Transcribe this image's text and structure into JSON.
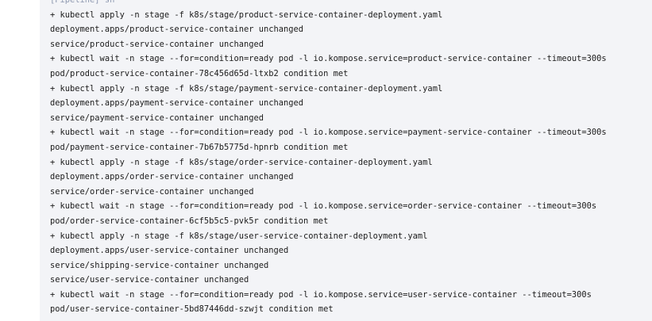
{
  "console": {
    "lines": [
      {
        "text": "[Pipeline] sh",
        "kind": "meta"
      },
      {
        "text": "+ kubectl apply -n stage -f k8s/stage/product-service-container-deployment.yaml",
        "kind": "command"
      },
      {
        "text": "deployment.apps/product-service-container unchanged",
        "kind": "output"
      },
      {
        "text": "service/product-service-container unchanged",
        "kind": "output"
      },
      {
        "text": "+ kubectl wait -n stage --for=condition=ready pod -l io.kompose.service=product-service-container --timeout=300s",
        "kind": "command"
      },
      {
        "text": "pod/product-service-container-78c456d65d-ltxb2 condition met",
        "kind": "output"
      },
      {
        "text": "+ kubectl apply -n stage -f k8s/stage/payment-service-container-deployment.yaml",
        "kind": "command"
      },
      {
        "text": "deployment.apps/payment-service-container unchanged",
        "kind": "output"
      },
      {
        "text": "service/payment-service-container unchanged",
        "kind": "output"
      },
      {
        "text": "+ kubectl wait -n stage --for=condition=ready pod -l io.kompose.service=payment-service-container --timeout=300s",
        "kind": "command"
      },
      {
        "text": "pod/payment-service-container-7b67b5775d-hpnrb condition met",
        "kind": "output"
      },
      {
        "text": "+ kubectl apply -n stage -f k8s/stage/order-service-container-deployment.yaml",
        "kind": "command"
      },
      {
        "text": "deployment.apps/order-service-container unchanged",
        "kind": "output"
      },
      {
        "text": "service/order-service-container unchanged",
        "kind": "output"
      },
      {
        "text": "+ kubectl wait -n stage --for=condition=ready pod -l io.kompose.service=order-service-container --timeout=300s",
        "kind": "command"
      },
      {
        "text": "pod/order-service-container-6cf5b5c5-pvk5r condition met",
        "kind": "output"
      },
      {
        "text": "+ kubectl apply -n stage -f k8s/stage/user-service-container-deployment.yaml",
        "kind": "command"
      },
      {
        "text": "deployment.apps/user-service-container unchanged",
        "kind": "output"
      },
      {
        "text": "service/shipping-service-container unchanged",
        "kind": "output"
      },
      {
        "text": "service/user-service-container unchanged",
        "kind": "output"
      },
      {
        "text": "+ kubectl wait -n stage --for=condition=ready pod -l io.kompose.service=user-service-container --timeout=300s",
        "kind": "command"
      },
      {
        "text": "pod/user-service-container-5bd87446dd-szwjt condition met",
        "kind": "output"
      }
    ]
  }
}
